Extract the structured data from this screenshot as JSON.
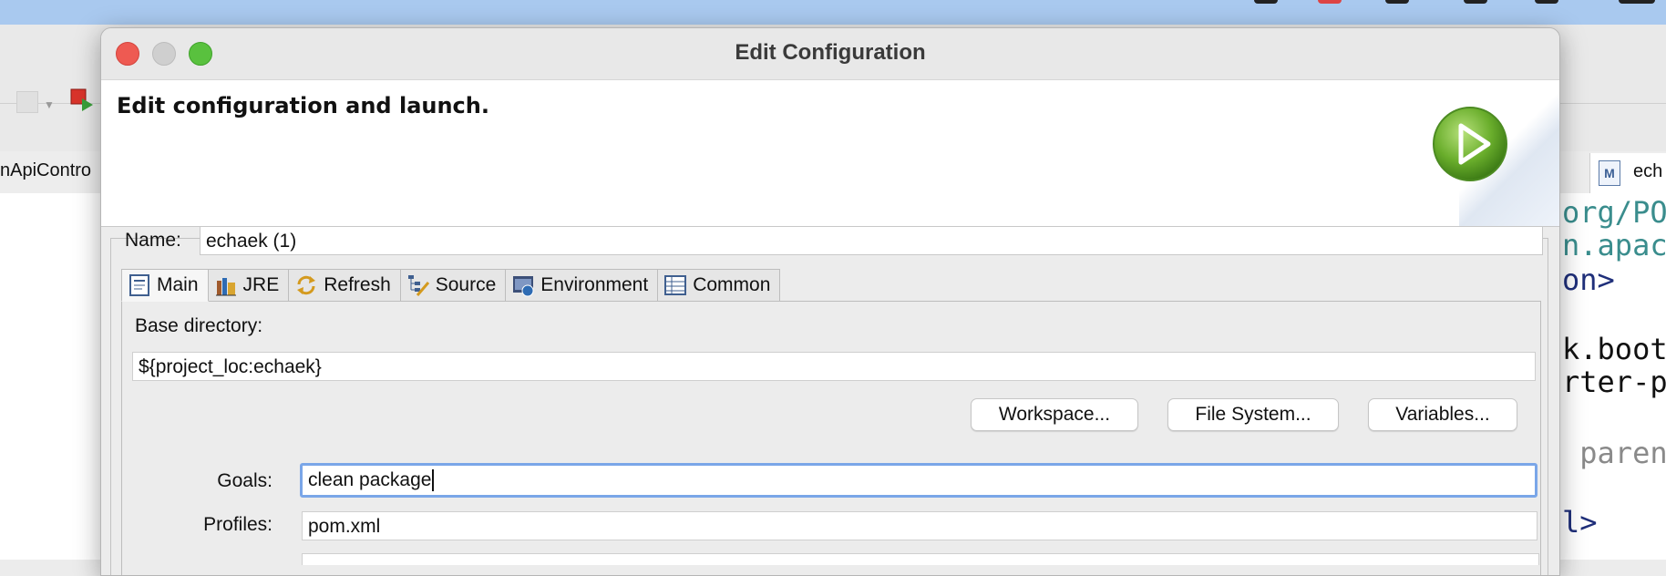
{
  "dialog": {
    "title": "Edit Configuration",
    "header_text": "Edit configuration and launch.",
    "name_label": "Name:",
    "name_value": "echaek (1)"
  },
  "tabs": [
    {
      "label": "Main",
      "icon": "main-tab-icon",
      "active": true
    },
    {
      "label": "JRE",
      "icon": "jre-books-icon"
    },
    {
      "label": "Refresh",
      "icon": "refresh-arrows-icon"
    },
    {
      "label": "Source",
      "icon": "source-tree-icon"
    },
    {
      "label": "Environment",
      "icon": "environment-icon"
    },
    {
      "label": "Common",
      "icon": "common-table-icon"
    }
  ],
  "main": {
    "base_dir_label": "Base directory:",
    "base_dir_value": "${project_loc:echaek}",
    "buttons": {
      "workspace": "Workspace...",
      "file_system": "File System...",
      "variables": "Variables..."
    },
    "goals_label": "Goals:",
    "goals_value": "clean package",
    "profiles_label": "Profiles:",
    "profiles_value": "pom.xml"
  },
  "background": {
    "left_tab_label": "nApiContro",
    "right_tab_label": "ech",
    "code_lines": [
      {
        "text": "org/PO",
        "color": "teal"
      },
      {
        "text": "n.apach",
        "color": "teal"
      },
      {
        "text": "on>",
        "color": "navy"
      },
      {
        "text": "k.boot<",
        "color": "black"
      },
      {
        "text": "rter-pa",
        "color": "black"
      },
      {
        "text": " parent",
        "color": "gray"
      },
      {
        "text": "l>",
        "color": "navy"
      }
    ]
  },
  "colors": {
    "accent": "#7aa6e8",
    "menubar": "#a9c9ef",
    "close": "#ee5a52",
    "zoom": "#59c13e"
  }
}
